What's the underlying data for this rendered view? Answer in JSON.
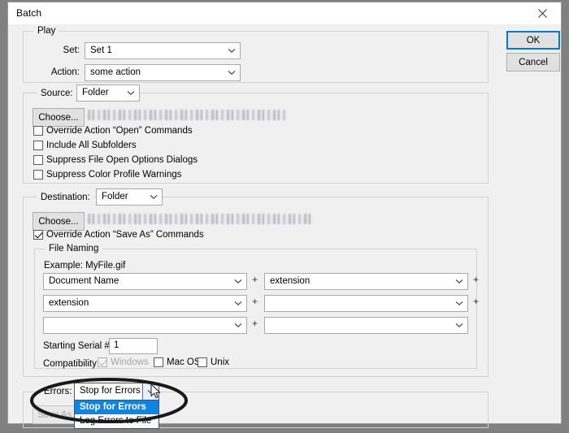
{
  "window": {
    "title": "Batch",
    "close_icon": "close-icon"
  },
  "buttons": {
    "ok": "OK",
    "cancel": "Cancel",
    "choose_source": "Choose...",
    "choose_destination": "Choose...",
    "save_as": "Save As..."
  },
  "play": {
    "legend": "Play",
    "set_label": "Set:",
    "set_value": "Set 1",
    "action_label": "Action:",
    "action_value": "some action"
  },
  "source": {
    "legend": "Source:",
    "value": "Folder",
    "path_redacted": "",
    "checkboxes": [
      {
        "label": "Override Action “Open” Commands",
        "checked": false,
        "disabled": false
      },
      {
        "label": "Include All Subfolders",
        "checked": false,
        "disabled": false
      },
      {
        "label": "Suppress File Open Options Dialogs",
        "checked": false,
        "disabled": false
      },
      {
        "label": "Suppress Color Profile Warnings",
        "checked": false,
        "disabled": false
      }
    ]
  },
  "destination": {
    "legend": "Destination:",
    "value": "Folder",
    "path_redacted": "",
    "override_saveas": {
      "label": "Override Action “Save As” Commands",
      "checked": true
    },
    "file_naming": {
      "legend": "File Naming",
      "example_label": "Example: MyFile.gif",
      "rows": [
        {
          "left": "Document Name",
          "plus": "+",
          "right": "extension",
          "trailing_plus": "+"
        },
        {
          "left": "extension",
          "plus": "+",
          "right": "",
          "trailing_plus": "+"
        },
        {
          "left": "",
          "plus": "+",
          "right": "",
          "trailing_plus": ""
        }
      ],
      "serial_label": "Starting Serial #:",
      "serial_value": "1",
      "compatibility_label": "Compatibility:",
      "compatibility": [
        {
          "label": "Windows",
          "checked": true,
          "disabled": true
        },
        {
          "label": "Mac OS",
          "checked": false,
          "disabled": false
        },
        {
          "label": "Unix",
          "checked": false,
          "disabled": false
        }
      ]
    }
  },
  "errors": {
    "label": "Errors:",
    "selected_value": "Stop for Errors",
    "options": [
      {
        "label": "Stop for Errors",
        "selected": true
      },
      {
        "label": "Log Errors to File",
        "selected": false
      }
    ]
  },
  "colors": {
    "accent_blue": "#1184e0",
    "focus_blue": "#0078d7",
    "dialog_bg": "#f0f0f0",
    "desktop_bg": "#808080",
    "group_border": "#d2d2d2",
    "annotation": "#1a1a1a"
  },
  "annotation": {
    "shape": "ellipse-highlight",
    "target": "errors-dropdown"
  },
  "cursor": {
    "icon": "arrow-pointer-cursor"
  }
}
